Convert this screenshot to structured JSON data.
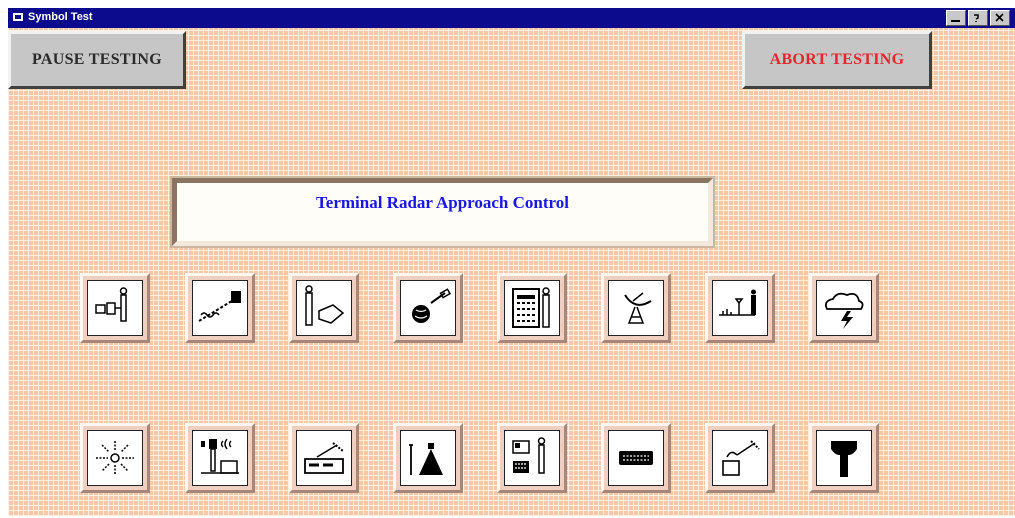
{
  "window": {
    "title": "Symbol Test"
  },
  "buttons": {
    "pause": "PAUSE TESTING",
    "abort": "ABORT TESTING"
  },
  "banner": {
    "text": "Terminal Radar Approach Control"
  },
  "colors": {
    "titlebar": "#0c0b8d",
    "abort_text": "#e8242a",
    "banner_text": "#1717e6",
    "background": "#f7c7a8"
  },
  "symbols_row1": [
    "radar-station-icon",
    "telemetry-link-icon",
    "tower-vehicle-icon",
    "satellite-globe-icon",
    "control-building-icon",
    "satellite-dish-icon",
    "antenna-array-icon",
    "storm-cloud-icon"
  ],
  "symbols_row2": [
    "signal-burst-icon",
    "relay-station-icon",
    "uplink-truck-icon",
    "antenna-mountain-icon",
    "radar-console-icon",
    "display-unit-icon",
    "mobile-dish-icon",
    "control-tower-icon"
  ]
}
